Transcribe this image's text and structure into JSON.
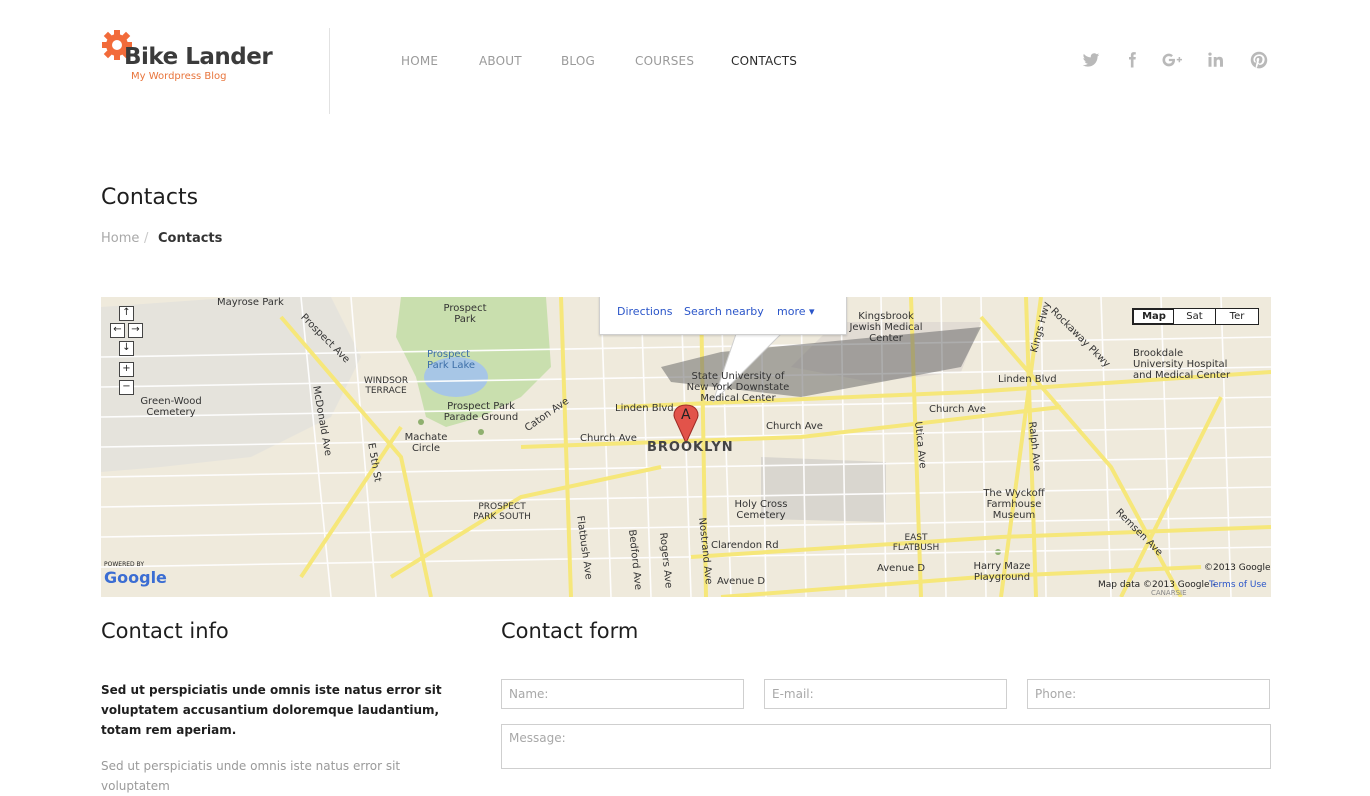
{
  "brand": {
    "title": "Bike Lander",
    "subtitle": "My Wordpress Blog",
    "accent": "#f26b3a"
  },
  "nav": {
    "items": [
      {
        "label": "HOME"
      },
      {
        "label": "ABOUT"
      },
      {
        "label": "BLOG"
      },
      {
        "label": "COURSES"
      },
      {
        "label": "CONTACTS",
        "active": true
      }
    ]
  },
  "social": [
    "twitter-icon",
    "facebook-icon",
    "google-plus-icon",
    "linkedin-icon",
    "pinterest-icon"
  ],
  "page": {
    "title": "Contacts",
    "breadcrumb": {
      "home": "Home",
      "separator": "/",
      "current": "Contacts"
    }
  },
  "map": {
    "bubble": {
      "directions": "Directions",
      "search_nearby": "Search nearby",
      "more": "more"
    },
    "types": {
      "map": "Map",
      "sat": "Sat",
      "ter": "Ter"
    },
    "marker": "A",
    "labels": {
      "brooklyn": "BROOKLYN",
      "prospect_park": "Prospect Park",
      "prospect_park_lake": "Prospect Park Lake",
      "parade_ground": "Prospect Park Parade Ground",
      "green_wood": "Green-Wood Cemetery",
      "holy_cross": "Holy Cross Cemetery",
      "kingsbrook": "Kingsbrook Jewish Medical Center",
      "suny": "State University of New York Downstate Medical Center",
      "brookdale": "Brookdale University Hospital and Medical Center",
      "wyckoff": "The Wyckoff Farmhouse Museum",
      "harry_maze": "Harry Maze Playground",
      "east_flatbush": "EAST FLATBUSH",
      "prospect_park_south": "PROSPECT PARK SOUTH",
      "windsor_terrace": "WINDSOR TERRACE",
      "machate": "Machate Circle",
      "mayrose": "Mayrose Park",
      "linden_blvd": "Linden Blvd",
      "church_ave": "Church Ave",
      "clarendon_rd": "Clarendon Rd",
      "avenue_d": "Avenue D",
      "flatbush_ave": "Flatbush Ave",
      "nostrand_ave": "Nostrand Ave",
      "bedford_ave": "Bedford Ave",
      "rogers_ave": "Rogers Ave",
      "utica_ave": "Utica Ave",
      "ralph_ave": "Ralph Ave",
      "remsen_ave": "Remsen Ave",
      "kings_hwy": "Kings Hwy",
      "rockaway_pkwy": "Rockaway Pkwy",
      "caton_ave": "Caton Ave",
      "prospect_ave": "Prospect Ave",
      "mcdonald_ave": "McDonald Ave",
      "e5th_st": "E 5th St"
    },
    "powered_by": "POWERED BY",
    "google": "Google",
    "copyright": "©2013 Google -",
    "map_data": "Map data ©2013 Google -",
    "terms": "Terms of Use",
    "canarsie": "CANARSIE"
  },
  "contact_info": {
    "heading": "Contact info",
    "bold_text": "Sed ut perspiciatis unde omnis iste natus error sit voluptatem accusantium doloremque laudantium, totam rem aperiam.",
    "text": "Sed ut perspiciatis unde omnis iste natus error sit voluptatem"
  },
  "contact_form": {
    "heading": "Contact form",
    "name_placeholder": "Name:",
    "email_placeholder": "E-mail:",
    "phone_placeholder": "Phone:",
    "message_placeholder": "Message:"
  },
  "colors": {
    "nav_text": "#9a9a9a",
    "nav_active": "#2b2b2b",
    "subtitle": "#e8743b",
    "map_bg": "#efeadc",
    "park": "#c9dfae",
    "road_yellow": "#f6e77a"
  }
}
